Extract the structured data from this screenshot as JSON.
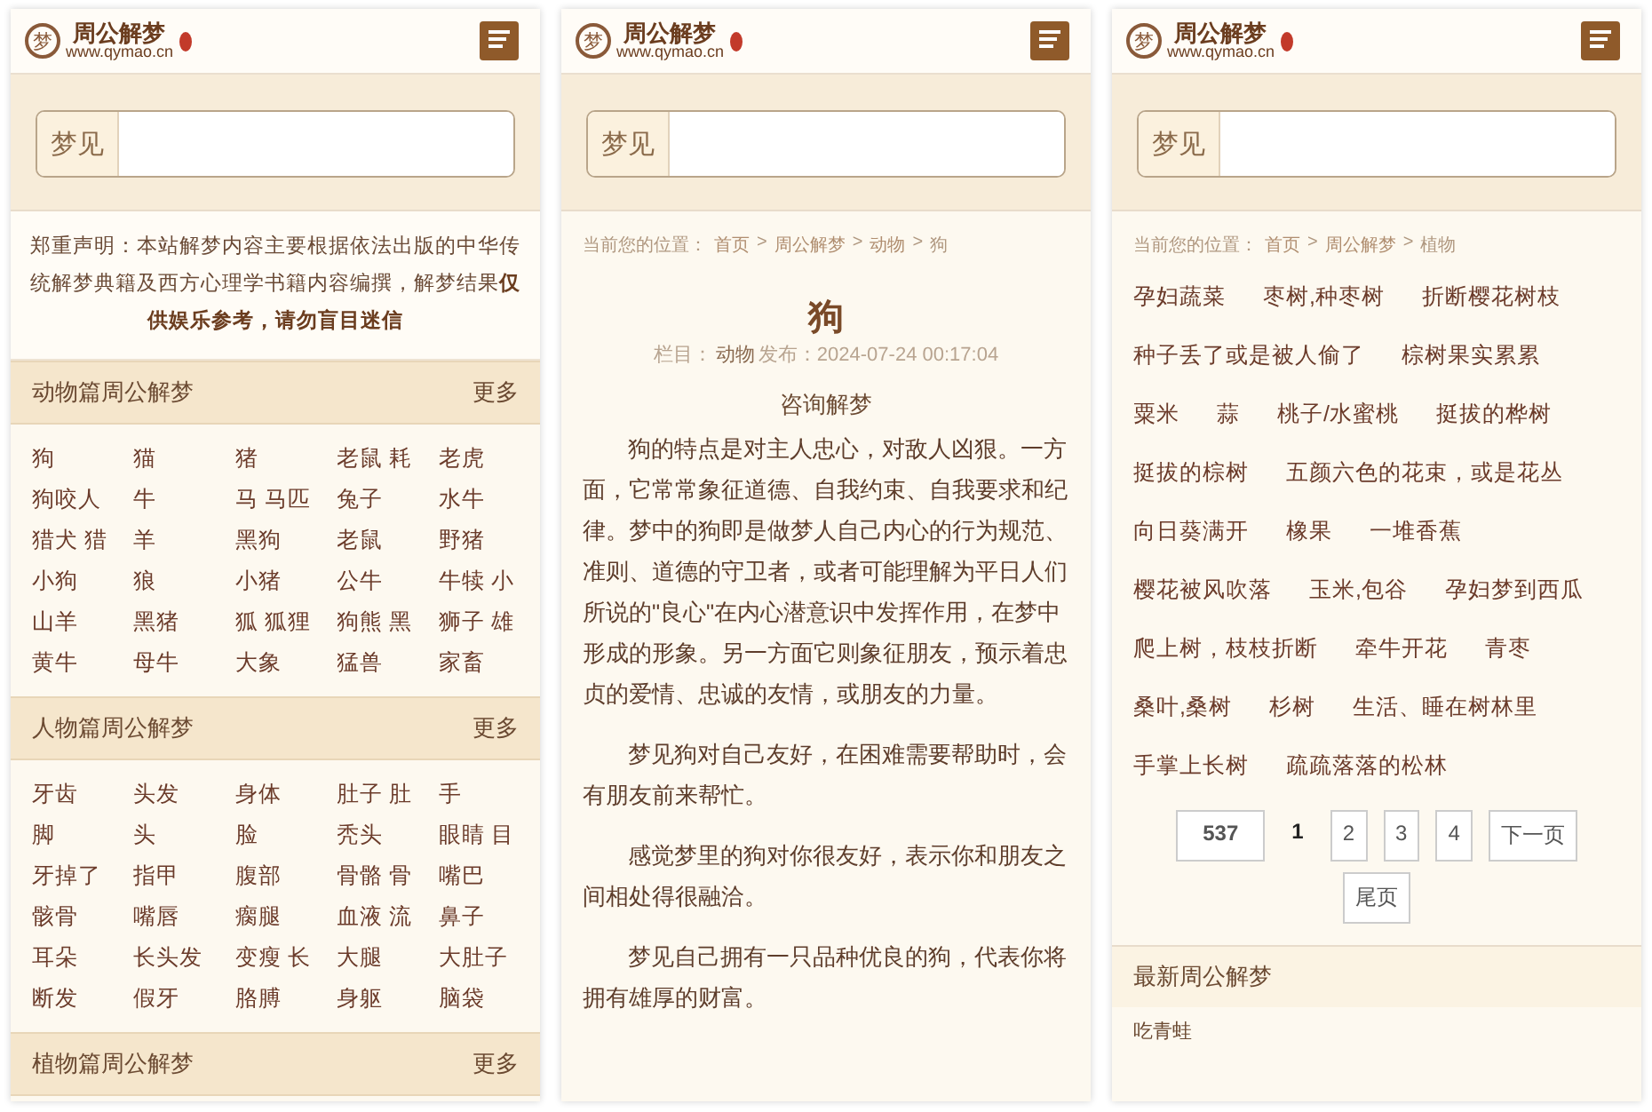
{
  "screens": [
    {
      "kind": "home",
      "header": {
        "logo_mark": "梦",
        "site_name": "周公解梦",
        "site_url": "www.qymao.cn"
      },
      "search": {
        "label": "梦见"
      },
      "notice": "郑重声明：本站解梦内容主要根据依法出版的中华传统解梦典籍及西方心理学书籍内容编撰，解梦结果**仅供娱乐参考，请勿盲目迷信**",
      "sections": [
        {
          "title": "动物篇周公解梦",
          "more": "更多",
          "items": [
            "狗",
            "猫",
            "猪",
            "老鼠 耗",
            "老虎",
            "狗咬人",
            "牛",
            "马 马匹",
            "兔子",
            "水牛",
            "猎犬 猎",
            "羊",
            "黑狗",
            "老鼠",
            "野猪",
            "小狗",
            "狼",
            "小猪",
            "公牛",
            "牛犊 小",
            "山羊",
            "黑猪",
            "狐 狐狸",
            "狗熊 黑",
            "狮子 雄",
            "黄牛",
            "母牛",
            "大象",
            "猛兽",
            "家畜"
          ]
        },
        {
          "title": "人物篇周公解梦",
          "more": "更多",
          "items": [
            "牙齿",
            "头发",
            "身体",
            "肚子 肚",
            "手",
            "脚",
            "头",
            "脸",
            "秃头",
            "眼睛 目",
            "牙掉了",
            "指甲",
            "腹部",
            "骨骼 骨",
            "嘴巴",
            "骸骨",
            "嘴唇",
            "瘸腿",
            "血液 流",
            "鼻子",
            "耳朵",
            "长头发",
            "变瘦 长",
            "大腿",
            "大肚子",
            "断发",
            "假牙",
            "胳膊",
            "身躯",
            "脑袋"
          ]
        },
        {
          "title": "植物篇周公解梦",
          "more": "更多"
        }
      ]
    },
    {
      "kind": "article",
      "header": {
        "logo_mark": "梦",
        "site_name": "周公解梦",
        "site_url": "www.qymao.cn"
      },
      "search": {
        "label": "梦见"
      },
      "breadcrumb": {
        "label": "当前您的位置：",
        "separator": ">",
        "links": [
          "首页",
          "周公解梦",
          "动物"
        ],
        "current": "狗"
      },
      "article": {
        "title": "狗",
        "category_label": "栏目：",
        "category": "动物",
        "published": "发布：2024-07-24 00:17:04",
        "subtitle": "咨询解梦",
        "paragraphs": [
          "狗的特点是对主人忠心，对敌人凶狠。一方面，它常常象征道德、自我约束、自我要求和纪律。梦中的狗即是做梦人自己内心的行为规范、准则、道德的守卫者，或者可能理解为平日人们所说的\"良心\"在内心潜意识中发挥作用，在梦中形成的形象。另一方面它则象征朋友，预示着忠贞的爱情、忠诚的友情，或朋友的力量。",
          "梦见狗对自己友好，在困难需要帮助时，会有朋友前来帮忙。",
          "感觉梦里的狗对你很友好，表示你和朋友之间相处得很融洽。",
          "梦见自己拥有一只品种优良的狗，代表你将拥有雄厚的财富。"
        ]
      }
    },
    {
      "kind": "list",
      "header": {
        "logo_mark": "梦",
        "site_name": "周公解梦",
        "site_url": "www.qymao.cn"
      },
      "search": {
        "label": "梦见"
      },
      "breadcrumb": {
        "label": "当前您的位置：",
        "separator": ">",
        "links": [
          "首页",
          "周公解梦"
        ],
        "current": "植物"
      },
      "tags": [
        "孕妇蔬菜",
        "枣树,种枣树",
        "折断樱花树枝",
        "种子丢了或是被人偷了",
        "棕树果实累累",
        "粟米",
        "蒜",
        "桃子/水蜜桃",
        "挺拔的桦树",
        "挺拔的棕树",
        "五颜六色的花束，或是花丛",
        "向日葵满开",
        "橡果",
        "一堆香蕉",
        "樱花被风吹落",
        "玉米,包谷",
        "孕妇梦到西瓜",
        "爬上树，枝枝折断",
        "牵牛开花",
        "青枣",
        "桑叶,桑树",
        "杉树",
        "生活、睡在树林里",
        "手掌上长树",
        "疏疏落落的松林"
      ],
      "pager": [
        {
          "label": "537",
          "kind": "count",
          "selected": false
        },
        {
          "label": "1",
          "kind": "page",
          "selected": true
        },
        {
          "label": "2",
          "kind": "page",
          "selected": false
        },
        {
          "label": "3",
          "kind": "page",
          "selected": false
        },
        {
          "label": "4",
          "kind": "page",
          "selected": false
        },
        {
          "label": "下一页",
          "kind": "page",
          "selected": false
        },
        {
          "label": "尾页",
          "kind": "last",
          "selected": false
        }
      ],
      "latest": {
        "title": "最新周公解梦",
        "items": [
          "吃青蛙"
        ]
      }
    }
  ]
}
